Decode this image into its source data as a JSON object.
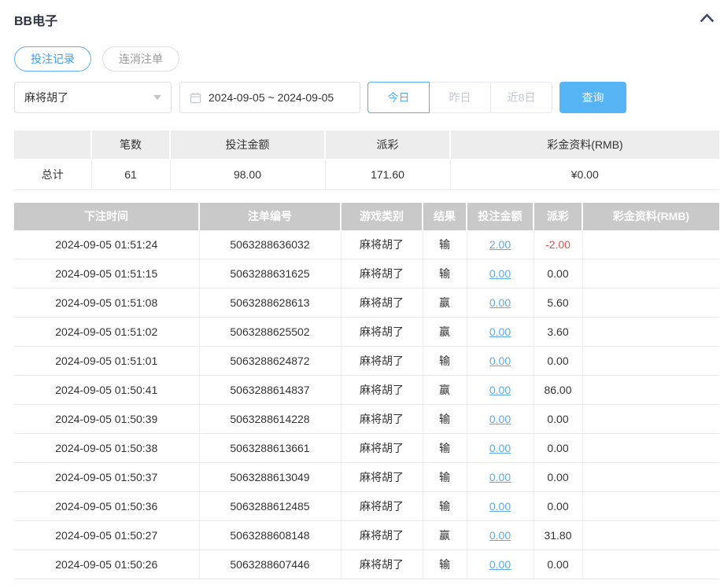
{
  "panel": {
    "title": "BB电子"
  },
  "tabs": [
    {
      "label": "投注记录",
      "active": true
    },
    {
      "label": "连消注单",
      "active": false
    }
  ],
  "filters": {
    "game_select": {
      "value": "麻将胡了"
    },
    "date_range": {
      "value": "2024-09-05 ~ 2024-09-05"
    },
    "quick_ranges": [
      {
        "label": "今日",
        "active": true
      },
      {
        "label": "昨日",
        "active": false
      },
      {
        "label": "近8日",
        "active": false
      }
    ],
    "query_button": "查询"
  },
  "summary": {
    "headers": [
      "",
      "笔数",
      "投注金额",
      "派彩",
      "彩金资料(RMB)"
    ],
    "totals": [
      "总计",
      "61",
      "98.00",
      "171.60",
      "¥0.00"
    ]
  },
  "table": {
    "headers": [
      "下注时间",
      "注单编号",
      "游戏类别",
      "结果",
      "投注金额",
      "派彩",
      "彩金资料(RMB)"
    ],
    "rows": [
      {
        "time": "2024-09-05 01:51:24",
        "order_no": "5063288636032",
        "game": "麻将胡了",
        "result": "输",
        "bet_amount": "2.00",
        "payout": "-2.00",
        "payout_negative": true,
        "bonus": ""
      },
      {
        "time": "2024-09-05 01:51:15",
        "order_no": "5063288631625",
        "game": "麻将胡了",
        "result": "输",
        "bet_amount": "0.00",
        "payout": "0.00",
        "payout_negative": false,
        "bonus": ""
      },
      {
        "time": "2024-09-05 01:51:08",
        "order_no": "5063288628613",
        "game": "麻将胡了",
        "result": "赢",
        "bet_amount": "0.00",
        "payout": "5.60",
        "payout_negative": false,
        "bonus": ""
      },
      {
        "time": "2024-09-05 01:51:02",
        "order_no": "5063288625502",
        "game": "麻将胡了",
        "result": "赢",
        "bet_amount": "0.00",
        "payout": "3.60",
        "payout_negative": false,
        "bonus": ""
      },
      {
        "time": "2024-09-05 01:51:01",
        "order_no": "5063288624872",
        "game": "麻将胡了",
        "result": "输",
        "bet_amount": "0.00",
        "payout": "0.00",
        "payout_negative": false,
        "bonus": ""
      },
      {
        "time": "2024-09-05 01:50:41",
        "order_no": "5063288614837",
        "game": "麻将胡了",
        "result": "赢",
        "bet_amount": "0.00",
        "payout": "86.00",
        "payout_negative": false,
        "bonus": ""
      },
      {
        "time": "2024-09-05 01:50:39",
        "order_no": "5063288614228",
        "game": "麻将胡了",
        "result": "输",
        "bet_amount": "0.00",
        "payout": "0.00",
        "payout_negative": false,
        "bonus": ""
      },
      {
        "time": "2024-09-05 01:50:38",
        "order_no": "5063288613661",
        "game": "麻将胡了",
        "result": "输",
        "bet_amount": "0.00",
        "payout": "0.00",
        "payout_negative": false,
        "bonus": ""
      },
      {
        "time": "2024-09-05 01:50:37",
        "order_no": "5063288613049",
        "game": "麻将胡了",
        "result": "输",
        "bet_amount": "0.00",
        "payout": "0.00",
        "payout_negative": false,
        "bonus": ""
      },
      {
        "time": "2024-09-05 01:50:36",
        "order_no": "5063288612485",
        "game": "麻将胡了",
        "result": "输",
        "bet_amount": "0.00",
        "payout": "0.00",
        "payout_negative": false,
        "bonus": ""
      },
      {
        "time": "2024-09-05 01:50:27",
        "order_no": "5063288608148",
        "game": "麻将胡了",
        "result": "赢",
        "bet_amount": "0.00",
        "payout": "31.80",
        "payout_negative": false,
        "bonus": ""
      },
      {
        "time": "2024-09-05 01:50:26",
        "order_no": "5063288607446",
        "game": "麻将胡了",
        "result": "输",
        "bet_amount": "0.00",
        "payout": "0.00",
        "payout_negative": false,
        "bonus": ""
      }
    ]
  },
  "colors": {
    "accent_blue": "#56b4f4",
    "tab_active_blue": "#3f9ef5",
    "link_blue": "#5caaea",
    "negative_red": "#ef5050",
    "table_header_gray": "#c9c9c9",
    "summary_header_gray": "#ededed"
  }
}
